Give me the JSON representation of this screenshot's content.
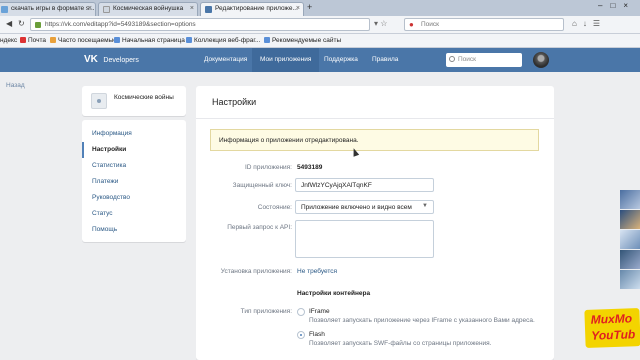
{
  "browser": {
    "tabs": [
      {
        "title": "скачать игры в формате s..."
      },
      {
        "title": "Космическая войнушка"
      },
      {
        "title": "Редактирование приложе..."
      }
    ],
    "new_tab": "+",
    "url": "https://vk.com/editapp?id=5493189&section=options",
    "search_placeholder": "Поиск",
    "bookmarks": [
      "ндекс",
      "Почта",
      "Часто посещаемые",
      "Начальная страница",
      "Коллекция веб-фраг...",
      "Рекомендуемые сайты"
    ]
  },
  "vk": {
    "logo": "Developers",
    "nav": [
      "Документация",
      "Мои приложения",
      "Поддержка",
      "Правила"
    ],
    "search_placeholder": "Поиск",
    "back": "Назад"
  },
  "sidebar": {
    "app_name": "Космические войны",
    "items": [
      "Информация",
      "Настройки",
      "Статистика",
      "Платежи",
      "Руководство",
      "Статус",
      "Помощь"
    ]
  },
  "main": {
    "title": "Настройки",
    "notice": "Информация о приложении отредактирована.",
    "fields": {
      "app_id_label": "ID приложения:",
      "app_id_value": "5493189",
      "secret_label": "Защищенный ключ:",
      "secret_value": "JnfWlzYCyAjqXAlTqnKF",
      "state_label": "Состояние:",
      "state_value": "Приложение включено и видно всем",
      "api_label": "Первый запрос к API:",
      "install_label": "Установка приложения:",
      "install_value": "Не требуется"
    },
    "container_section": "Настройки контейнера",
    "type_label": "Тип приложения:",
    "types": [
      {
        "name": "IFrame",
        "desc": "Позволяет запускать приложение через IFrame с указанного Вами адреса."
      },
      {
        "name": "Flash",
        "desc": "Позволяет запускать SWF-файлы со страницы приложения."
      }
    ]
  },
  "watermark": {
    "line1": "MuxMo",
    "line2": "YouTub"
  },
  "colors": {
    "vk_blue": "#4a76a8",
    "link": "#2a5885",
    "notice_bg": "#fefbe4"
  }
}
